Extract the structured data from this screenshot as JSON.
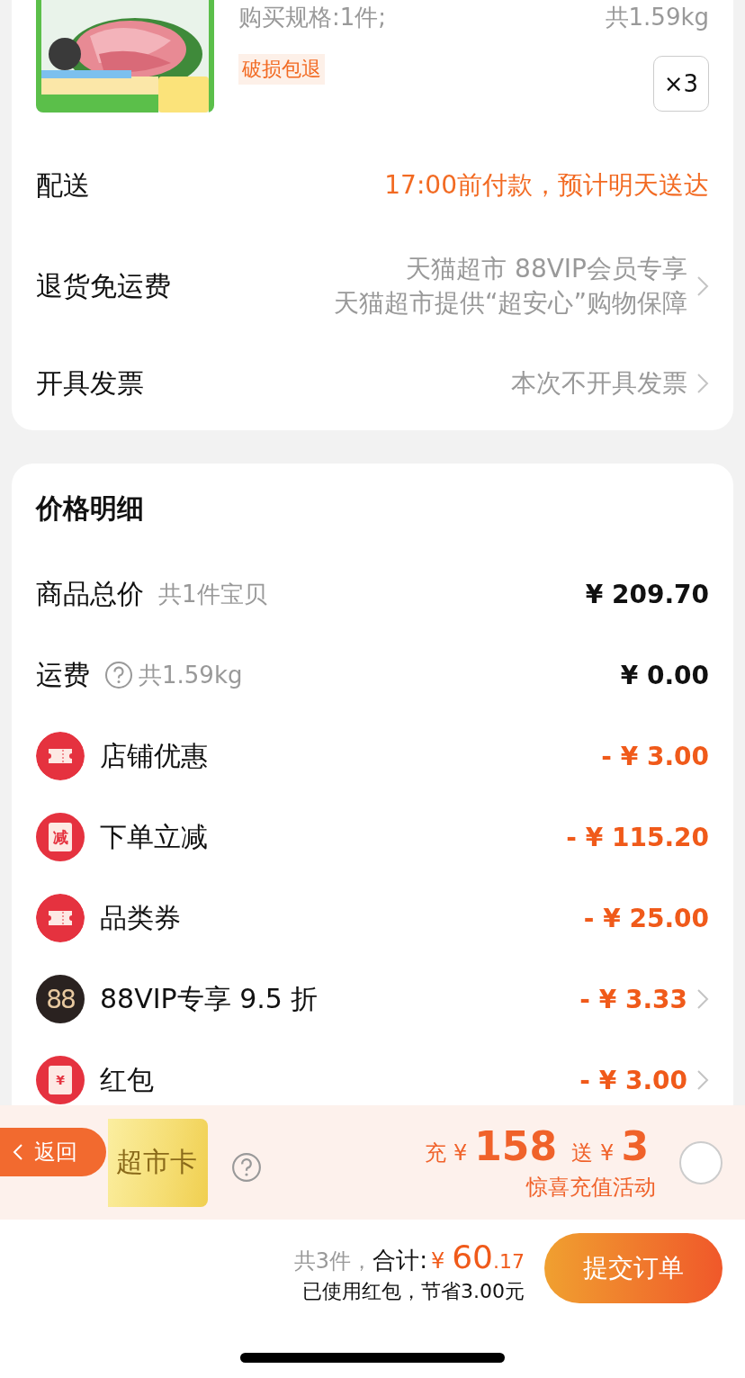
{
  "product": {
    "spec": "购买规格:1件;",
    "weight": "共1.59kg",
    "tag": "破损包退",
    "quantity": "×3"
  },
  "order_rows": [
    {
      "label": "配送",
      "values": [
        "17:00前付款，预计明天送达"
      ],
      "highlight": true,
      "chevron": false
    },
    {
      "label": "退货免运费",
      "values": [
        "天猫超市 88VIP会员专享",
        "天猫超市提供“超安心”购物保障"
      ],
      "highlight": false,
      "chevron": true
    },
    {
      "label": "开具发票",
      "values": [
        "本次不开具发票"
      ],
      "highlight": false,
      "chevron": true
    }
  ],
  "price_details": {
    "title": "价格明细",
    "rows": [
      {
        "kind": "plain",
        "label": "商品总价",
        "help": false,
        "note": "共1件宝贝",
        "amount": "¥ 209.70",
        "discount": false,
        "chevron": false
      },
      {
        "kind": "plain",
        "label": "运费",
        "help": true,
        "note": "共1.59kg",
        "amount": "¥ 0.00",
        "discount": false,
        "chevron": false
      },
      {
        "kind": "ticket",
        "label": "店铺优惠",
        "amount": "- ¥ 3.00",
        "discount": true,
        "chevron": false
      },
      {
        "kind": "reduce",
        "badge": "减",
        "label": "下单立减",
        "amount": "- ¥ 115.20",
        "discount": true,
        "chevron": false
      },
      {
        "kind": "ticket",
        "label": "品类券",
        "amount": "- ¥ 25.00",
        "discount": true,
        "chevron": false
      },
      {
        "kind": "vip",
        "badge": "88",
        "label": "88VIP专享 9.5 折",
        "amount": "- ¥ 3.33",
        "discount": true,
        "chevron": true
      },
      {
        "kind": "envelope",
        "badge": "¥",
        "label": "红包",
        "amount": "- ¥ 3.00",
        "discount": true,
        "chevron": true
      }
    ]
  },
  "recharge": {
    "back": "返回",
    "card_text": "超市卡",
    "help": true,
    "prefix": "充",
    "currency": "¥",
    "amount": "158",
    "bonus_prefix": "送",
    "bonus_currency": "¥",
    "bonus": "3",
    "caption": "惊喜充值活动",
    "selected": false
  },
  "footer": {
    "count": "共3件，",
    "total_label": "合计:",
    "currency": "¥",
    "total_int": "60",
    "total_dec": ".17",
    "note": "已使用红包，节省3.00元",
    "submit": "提交订单"
  }
}
